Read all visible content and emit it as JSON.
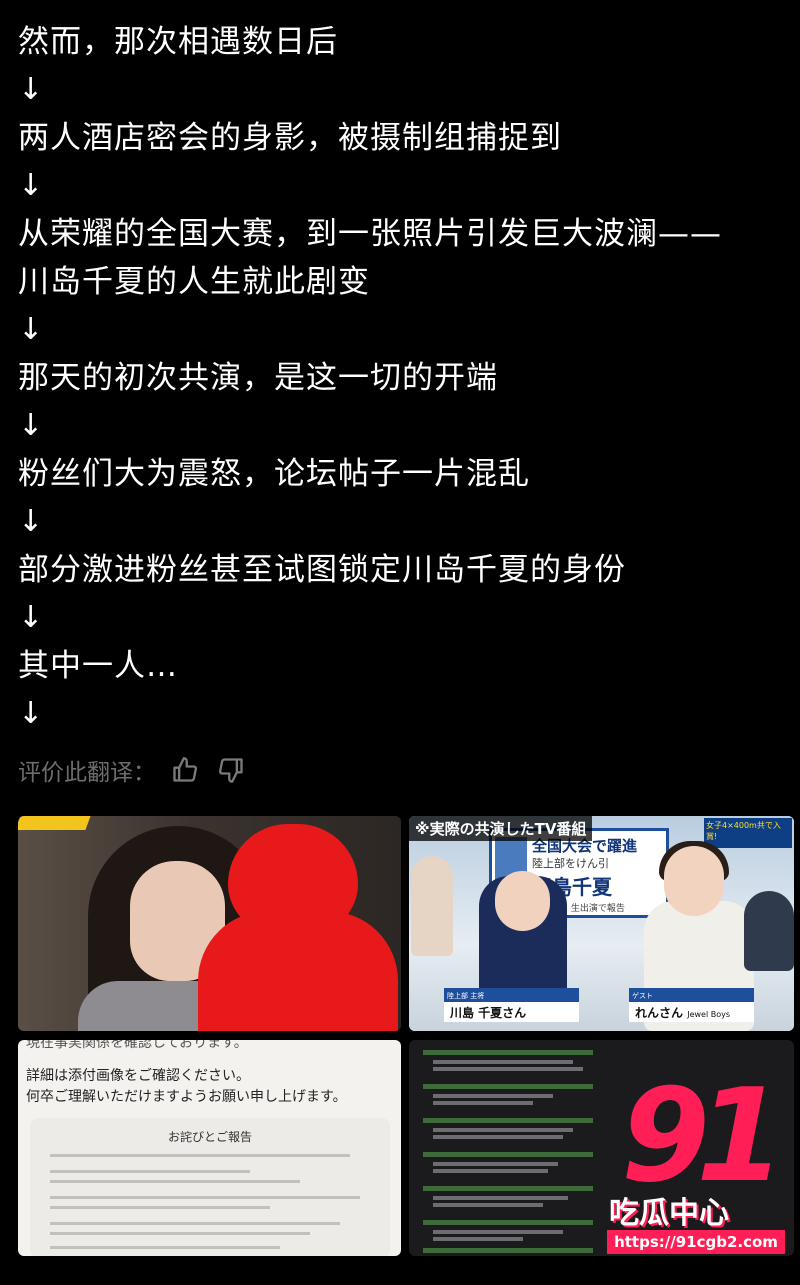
{
  "post": {
    "lines": [
      "然而，那次相遇数日后",
      "两人酒店密会的身影，被摄制组捕捉到",
      "从荣耀的全国大赛，到一张照片引发巨大波澜——",
      "川岛千夏的人生就此剧变",
      "那天的初次共演，是这一切的开端",
      "粉丝们大为震怒，论坛帖子一片混乱",
      "部分激进粉丝甚至试图锁定川岛千夏的身份",
      "其中一人…"
    ],
    "arrow": "↓"
  },
  "rating": {
    "label": "评价此翻译：",
    "thumbs_up_icon": "thumbs-up-icon",
    "thumbs_down_icon": "thumbs-down-icon"
  },
  "images": {
    "tv": {
      "tag": "※実際の共演したTV番組",
      "board_line1": "全国大会で躍進",
      "board_line2": "陸上部をけん引",
      "board_name": "川島千夏",
      "board_sub": "大会翌日 生出演で報告",
      "corner": "女子4×400m共で入賞!",
      "caption1_small": "陸上部 主将",
      "caption1_name": "川島 千夏さん",
      "caption2_small": "ゲスト",
      "caption2_name": "れんさん",
      "caption2_group": "Jewel Boys"
    },
    "document": {
      "line0": "現在事実関係を確認しております。",
      "line1": "詳細は添付画像をご確認ください。",
      "line2": "何卒ご理解いただけますようお願い申し上げます。",
      "paper_title": "お詫びとご報告"
    },
    "watermark": {
      "number": "91",
      "brand": "吃瓜中心",
      "url": "https://91cgb2.com"
    }
  }
}
